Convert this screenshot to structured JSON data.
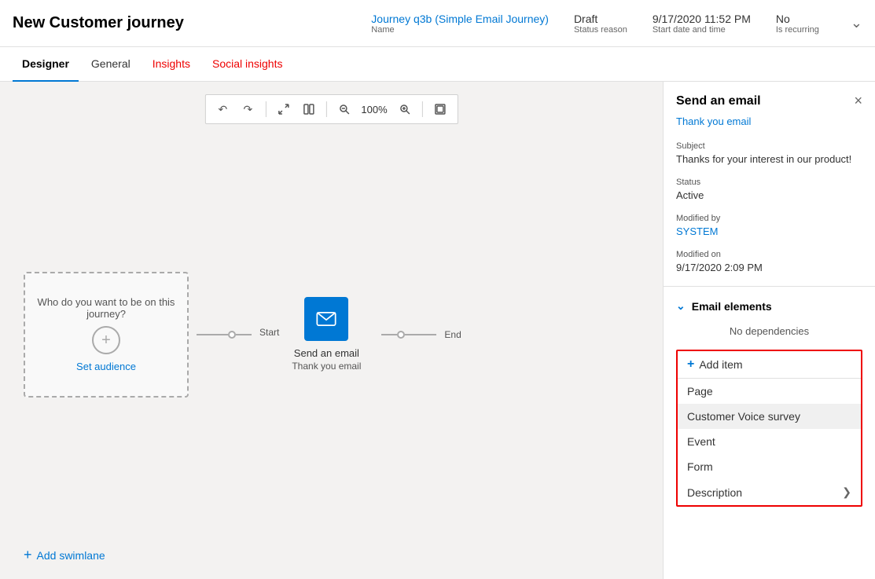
{
  "header": {
    "title": "New Customer journey",
    "meta": {
      "name_value": "Journey q3b (Simple Email Journey)",
      "name_label": "Name",
      "status_value": "Draft",
      "status_label": "Status reason",
      "date_value": "9/17/2020 11:52 PM",
      "date_label": "Start date and time",
      "recurring_value": "No",
      "recurring_label": "Is recurring"
    }
  },
  "tabs": [
    {
      "label": "Designer",
      "active": true,
      "color": "normal"
    },
    {
      "label": "General",
      "active": false,
      "color": "normal"
    },
    {
      "label": "Insights",
      "active": false,
      "color": "red"
    },
    {
      "label": "Social insights",
      "active": false,
      "color": "red"
    }
  ],
  "toolbar": {
    "undo_label": "↩",
    "redo_label": "↪",
    "expand_label": "⤢",
    "split_label": "⊞",
    "zoom_out_label": "🔍-",
    "zoom_value": "100%",
    "zoom_in_label": "🔍+",
    "fit_label": "⊡"
  },
  "canvas": {
    "audience_text": "Who do you want to be on this journey?",
    "plus_label": "+",
    "set_audience_label": "Set audience",
    "start_label": "Start",
    "end_label": "End",
    "email_node_label": "Send an email",
    "email_node_sublabel": "Thank you email",
    "add_swimlane_label": "Add swimlane"
  },
  "right_panel": {
    "title": "Send an email",
    "close_label": "×",
    "link_label": "Thank you email",
    "fields": [
      {
        "label": "Subject",
        "value": "Thanks for your interest in our product!",
        "type": "normal"
      },
      {
        "label": "Status",
        "value": "Active",
        "type": "normal"
      },
      {
        "label": "Modified by",
        "value": "SYSTEM",
        "type": "blue"
      },
      {
        "label": "Modified on",
        "value": "9/17/2020 2:09 PM",
        "type": "normal"
      }
    ],
    "email_elements_label": "Email elements",
    "no_dependencies_label": "No dependencies",
    "add_item_label": "Add item",
    "dropdown_items": [
      {
        "label": "Page",
        "selected": false
      },
      {
        "label": "Customer Voice survey",
        "selected": true
      },
      {
        "label": "Event",
        "selected": false
      },
      {
        "label": "Form",
        "selected": false
      },
      {
        "label": "Description",
        "selected": false,
        "has_chevron": true
      }
    ]
  }
}
